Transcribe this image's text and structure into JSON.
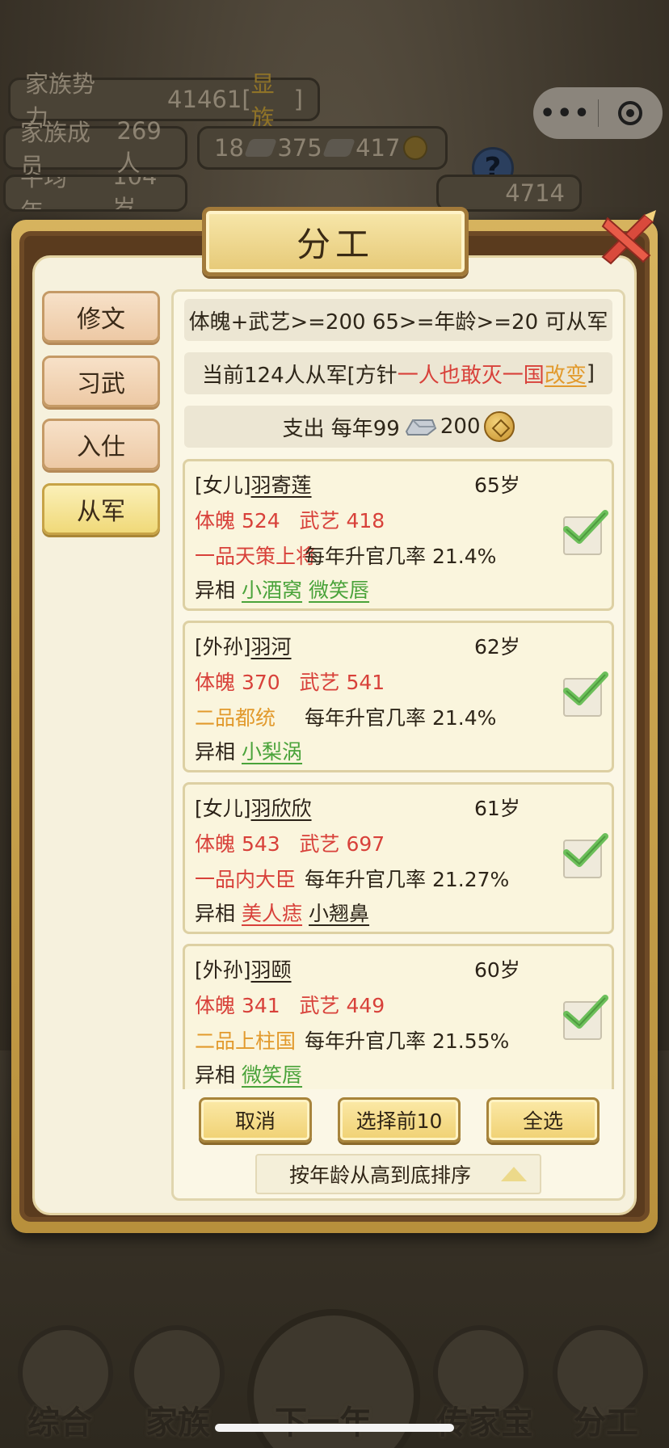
{
  "background": {
    "family_power_label": "家族势力",
    "family_power_value": "41461",
    "family_power_rank": "显族",
    "members_label": "家族成员",
    "members_value": "269人",
    "res_gold": "18",
    "res_silver": "375",
    "res_coin": "417",
    "row3_left": "平均年",
    "row3_mid": "104岁",
    "row3_right": "4714"
  },
  "capsule": {
    "more_icon": "more-dots-icon",
    "close_icon": "target-icon"
  },
  "modal": {
    "title": "分工",
    "tabs": [
      {
        "label": "修文",
        "active": false
      },
      {
        "label": "习武",
        "active": false
      },
      {
        "label": "入仕",
        "active": false
      },
      {
        "label": "从军",
        "active": true
      }
    ],
    "requirement": "体魄+武艺>=200 65>=年龄>=20 可从军",
    "status": {
      "prefix": "当前124人从军[方针",
      "policy": "一人也敢灭一国",
      "change": "改变",
      "suffix": "]"
    },
    "expense": {
      "prefix": "支出 每年99",
      "coin_amount": "200"
    },
    "members": [
      {
        "relation": "[女儿]",
        "name": "羽寄莲",
        "age": "65岁",
        "physique_label": "体魄",
        "physique": "524",
        "martial_label": "武艺",
        "martial": "418",
        "rank": "一品天策上将",
        "rank_color": "red",
        "promotion": "每年升官几率 21.4%",
        "traits_label": "异相",
        "traits": [
          {
            "text": "小酒窝",
            "color": "green"
          },
          {
            "text": "微笑唇",
            "color": "green"
          }
        ],
        "selected": true
      },
      {
        "relation": "[外孙]",
        "name": "羽河",
        "age": "62岁",
        "physique_label": "体魄",
        "physique": "370",
        "martial_label": "武艺",
        "martial": "541",
        "rank": "二品都统",
        "rank_color": "orange",
        "promotion": "每年升官几率 21.4%",
        "traits_label": "异相",
        "traits": [
          {
            "text": "小梨涡",
            "color": "green"
          }
        ],
        "selected": true
      },
      {
        "relation": "[女儿]",
        "name": "羽欣欣",
        "age": "61岁",
        "physique_label": "体魄",
        "physique": "543",
        "martial_label": "武艺",
        "martial": "697",
        "rank": "一品内大臣",
        "rank_color": "red",
        "promotion": "每年升官几率 21.27%",
        "traits_label": "异相",
        "traits": [
          {
            "text": "美人痣",
            "color": "red"
          },
          {
            "text": "小翘鼻",
            "color": "dark"
          }
        ],
        "selected": true
      },
      {
        "relation": "[外孙]",
        "name": "羽颐",
        "age": "60岁",
        "physique_label": "体魄",
        "physique": "341",
        "martial_label": "武艺",
        "martial": "449",
        "rank": "二品上柱国",
        "rank_color": "orange",
        "promotion": "每年升官几率 21.55%",
        "traits_label": "异相",
        "traits": [
          {
            "text": "微笑唇",
            "color": "green"
          }
        ],
        "selected": true
      }
    ],
    "buttons": {
      "cancel": "取消",
      "top10": "选择前10",
      "select_all": "全选"
    },
    "sort_label": "按年龄从高到底排序"
  },
  "bottom_nav": [
    "综合",
    "家族",
    "下一年",
    "传家宝",
    "分工"
  ],
  "colors": {
    "red": "#d8413a",
    "orange": "#e29a2d",
    "green": "#4aa33a",
    "gold": "#f0d173"
  }
}
